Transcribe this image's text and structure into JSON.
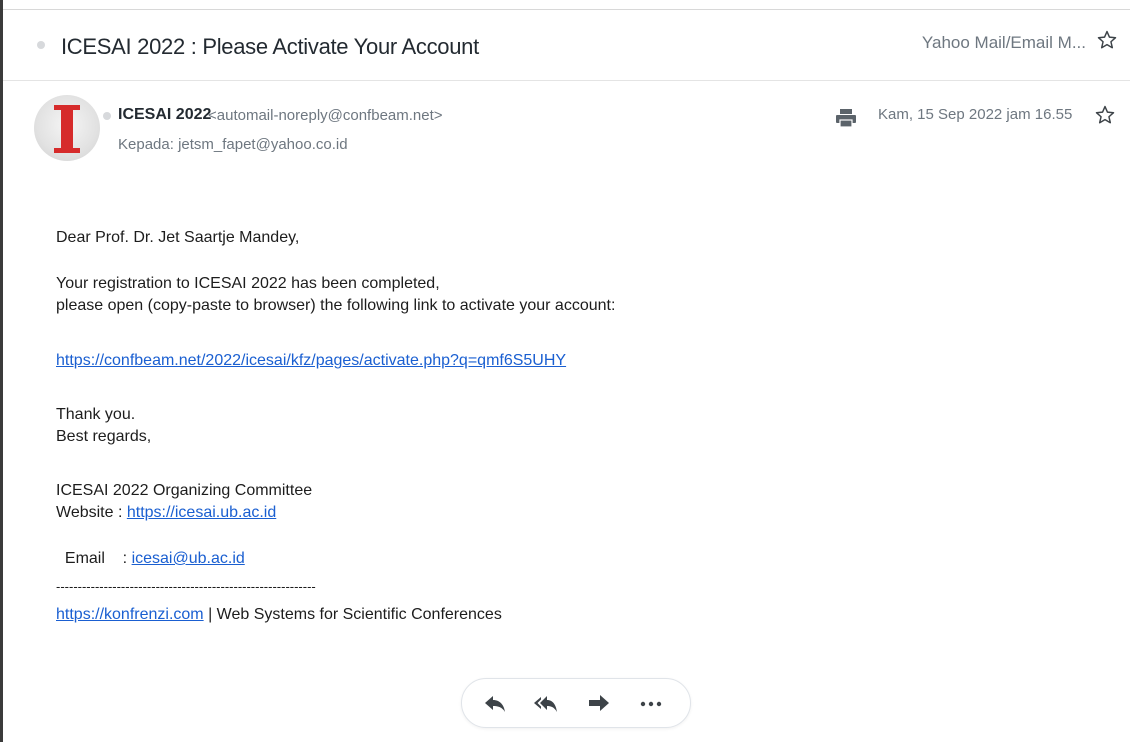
{
  "subject": {
    "title": "ICESAI 2022 : Please Activate Your Account",
    "folder": "Yahoo Mail/Email M..."
  },
  "message": {
    "sender_name": "ICESAI 2022",
    "sender_email": "<automail-noreply@confbeam.net>",
    "recipient_label": "Kepada:",
    "recipient": "jetsm_fapet@yahoo.co.id",
    "date": "Kam, 15 Sep 2022 jam 16.55",
    "avatar_letter": "I"
  },
  "body": {
    "greeting": "Dear Prof. Dr. Jet Saartje Mandey,",
    "line1": "Your registration to ICESAI 2022 has been completed,",
    "line2": "please open (copy-paste to browser) the following link to activate your account:",
    "activation_link": "https://confbeam.net/2022/icesai/kfz/pages/activate.php?q=qmf6S5UHY",
    "thanks": "Thank you.",
    "regards": "Best regards,",
    "committee": "ICESAI 2022 Organizing Committee",
    "website_label": "Website : ",
    "website_link": "https://icesai.ub.ac.id",
    "email_label": "Email    : ",
    "email_link": "icesai@ub.ac.id",
    "separator": "------------------------------------------------------------",
    "footer_link": "https://konfrenzi.com",
    "footer_text": " | Web Systems for Scientific Conferences"
  },
  "actions": {
    "icons": [
      "reply-icon",
      "reply-all-icon",
      "forward-icon",
      "more-icon"
    ]
  },
  "colors": {
    "link": "#1a5fd1",
    "muted": "#6e7780",
    "avatar_letter": "#d62b2b"
  }
}
